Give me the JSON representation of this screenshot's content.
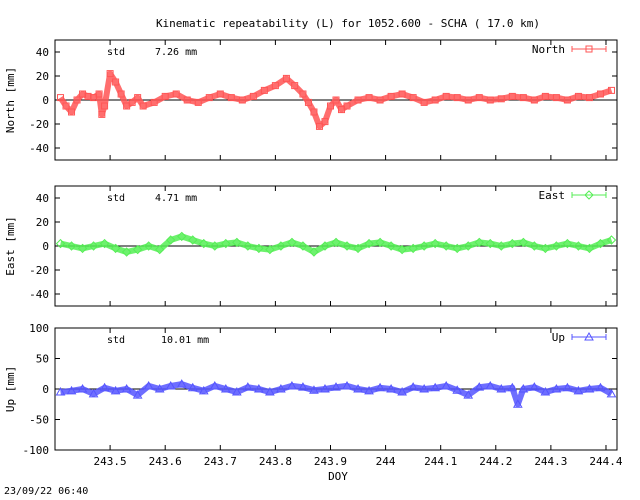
{
  "title": "Kinematic repeatability (L) for 1052.600 - SCHA  ( 17.0 km)",
  "xlabel": "DOY",
  "timestamp": "23/09/22 06:40",
  "chart_data": [
    {
      "type": "line",
      "name": "north",
      "ylabel": "North [mm]",
      "legend": "North",
      "legend_position": "top-right",
      "stat_label": "std",
      "stat_value": "7.26 mm",
      "color": "#ff5555",
      "marker": "square",
      "xlim": [
        243.4,
        244.42
      ],
      "ylim": [
        -50,
        50
      ],
      "yticks": [
        -40,
        -20,
        0,
        20,
        40
      ],
      "grid": false,
      "zero_line": true,
      "x": [
        243.41,
        243.42,
        243.43,
        243.44,
        243.45,
        243.46,
        243.47,
        243.48,
        243.485,
        243.49,
        243.5,
        243.51,
        243.52,
        243.53,
        243.54,
        243.55,
        243.56,
        243.58,
        243.6,
        243.62,
        243.64,
        243.66,
        243.68,
        243.7,
        243.72,
        243.74,
        243.76,
        243.78,
        243.8,
        243.82,
        243.835,
        243.85,
        243.86,
        243.87,
        243.88,
        243.89,
        243.9,
        243.91,
        243.92,
        243.93,
        243.95,
        243.97,
        243.99,
        244.01,
        244.03,
        244.05,
        244.07,
        244.09,
        244.11,
        244.13,
        244.15,
        244.17,
        244.19,
        244.21,
        244.23,
        244.25,
        244.27,
        244.29,
        244.31,
        244.33,
        244.35,
        244.37,
        244.39,
        244.41
      ],
      "values": [
        2,
        -5,
        -10,
        0,
        5,
        3,
        2,
        5,
        -12,
        -5,
        22,
        15,
        5,
        -5,
        -2,
        2,
        -5,
        -2,
        3,
        5,
        0,
        -2,
        2,
        5,
        2,
        0,
        3,
        8,
        12,
        18,
        12,
        5,
        -2,
        -10,
        -22,
        -18,
        -5,
        0,
        -8,
        -5,
        0,
        2,
        0,
        3,
        5,
        2,
        -2,
        0,
        3,
        2,
        0,
        2,
        0,
        1,
        3,
        2,
        0,
        3,
        2,
        0,
        3,
        2,
        5,
        8
      ]
    },
    {
      "type": "line",
      "name": "east",
      "ylabel": "East [mm]",
      "legend": "East",
      "legend_position": "top-right",
      "stat_label": "std",
      "stat_value": "4.71 mm",
      "color": "#55ee55",
      "marker": "diamond",
      "xlim": [
        243.4,
        244.42
      ],
      "ylim": [
        -50,
        50
      ],
      "yticks": [
        -40,
        -20,
        0,
        20,
        40
      ],
      "grid": false,
      "zero_line": true,
      "x": [
        243.41,
        243.43,
        243.45,
        243.47,
        243.49,
        243.51,
        243.53,
        243.55,
        243.57,
        243.59,
        243.61,
        243.63,
        243.65,
        243.67,
        243.69,
        243.71,
        243.73,
        243.75,
        243.77,
        243.79,
        243.81,
        243.83,
        243.85,
        243.87,
        243.89,
        243.91,
        243.93,
        243.95,
        243.97,
        243.99,
        244.01,
        244.03,
        244.05,
        244.07,
        244.09,
        244.11,
        244.13,
        244.15,
        244.17,
        244.19,
        244.21,
        244.23,
        244.25,
        244.27,
        244.29,
        244.31,
        244.33,
        244.35,
        244.37,
        244.39,
        244.41
      ],
      "values": [
        2,
        0,
        -2,
        0,
        2,
        -2,
        -5,
        -3,
        0,
        -3,
        5,
        8,
        5,
        2,
        0,
        2,
        3,
        0,
        -2,
        -3,
        0,
        3,
        0,
        -5,
        0,
        3,
        0,
        -2,
        2,
        3,
        0,
        -3,
        -2,
        0,
        2,
        0,
        -2,
        0,
        3,
        2,
        0,
        2,
        3,
        0,
        -2,
        0,
        2,
        0,
        -2,
        2,
        5
      ]
    },
    {
      "type": "line",
      "name": "up",
      "ylabel": "Up [mm]",
      "legend": "Up",
      "legend_position": "top-right",
      "stat_label": "std",
      "stat_value": "10.01 mm",
      "color": "#5555ff",
      "marker": "triangle",
      "xlim": [
        243.4,
        244.42
      ],
      "ylim": [
        -100,
        100
      ],
      "yticks": [
        -100,
        -50,
        0,
        50,
        100
      ],
      "grid": false,
      "zero_line": true,
      "x": [
        243.41,
        243.43,
        243.45,
        243.47,
        243.49,
        243.51,
        243.53,
        243.55,
        243.57,
        243.59,
        243.61,
        243.63,
        243.65,
        243.67,
        243.69,
        243.71,
        243.73,
        243.75,
        243.77,
        243.79,
        243.81,
        243.83,
        243.85,
        243.87,
        243.89,
        243.91,
        243.93,
        243.95,
        243.97,
        243.99,
        244.01,
        244.03,
        244.05,
        244.07,
        244.09,
        244.11,
        244.13,
        244.15,
        244.17,
        244.19,
        244.21,
        244.23,
        244.24,
        244.25,
        244.27,
        244.29,
        244.31,
        244.33,
        244.35,
        244.37,
        244.39,
        244.41
      ],
      "values": [
        -5,
        -3,
        0,
        -8,
        2,
        -3,
        0,
        -10,
        5,
        0,
        5,
        8,
        2,
        -3,
        5,
        0,
        -5,
        3,
        0,
        -5,
        0,
        5,
        3,
        -2,
        0,
        3,
        5,
        0,
        -3,
        2,
        0,
        -5,
        3,
        0,
        2,
        5,
        -2,
        -10,
        3,
        5,
        0,
        2,
        -25,
        0,
        3,
        -5,
        0,
        2,
        -3,
        0,
        2,
        -8
      ]
    }
  ],
  "xticks": {
    "values": [
      243.5,
      243.6,
      243.7,
      243.8,
      243.9,
      244,
      244.1,
      244.2,
      244.3,
      244.4
    ],
    "labels": [
      "243.5",
      "243.6",
      "243.7",
      "243.8",
      "243.9",
      "244",
      "244.1",
      "244.2",
      "244.3",
      "244.4"
    ]
  }
}
